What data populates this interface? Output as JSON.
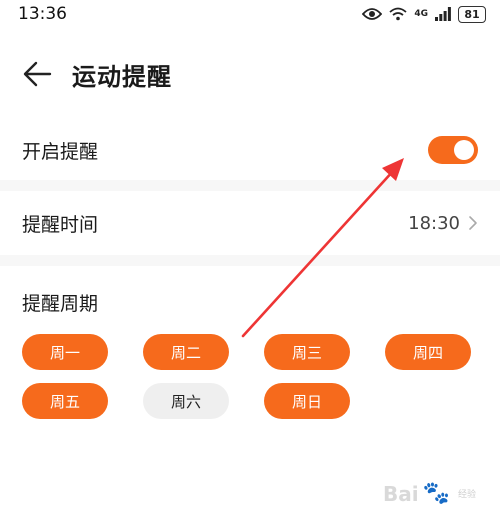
{
  "status_bar": {
    "time": "13:36",
    "eye_icon": "eye-icon",
    "wifi_icon": "wifi-icon",
    "network": "4G",
    "signal_icon": "signal-icon",
    "battery": "81"
  },
  "header": {
    "back_icon": "arrow-left-icon",
    "title": "运动提醒"
  },
  "reminder_toggle": {
    "label": "开启提醒",
    "enabled": true
  },
  "reminder_time": {
    "label": "提醒时间",
    "value": "18:30"
  },
  "reminder_cycle": {
    "label": "提醒周期",
    "days": [
      {
        "label": "周一",
        "selected": true
      },
      {
        "label": "周二",
        "selected": true
      },
      {
        "label": "周三",
        "selected": true
      },
      {
        "label": "周四",
        "selected": true
      },
      {
        "label": "周五",
        "selected": true
      },
      {
        "label": "周六",
        "selected": false
      },
      {
        "label": "周日",
        "selected": true
      }
    ]
  },
  "colors": {
    "accent": "#f66a1c",
    "annotation_arrow": "#ee3535",
    "pill_off": "#efefef"
  },
  "watermark": {
    "text": "Bai",
    "suffix": "经验"
  }
}
